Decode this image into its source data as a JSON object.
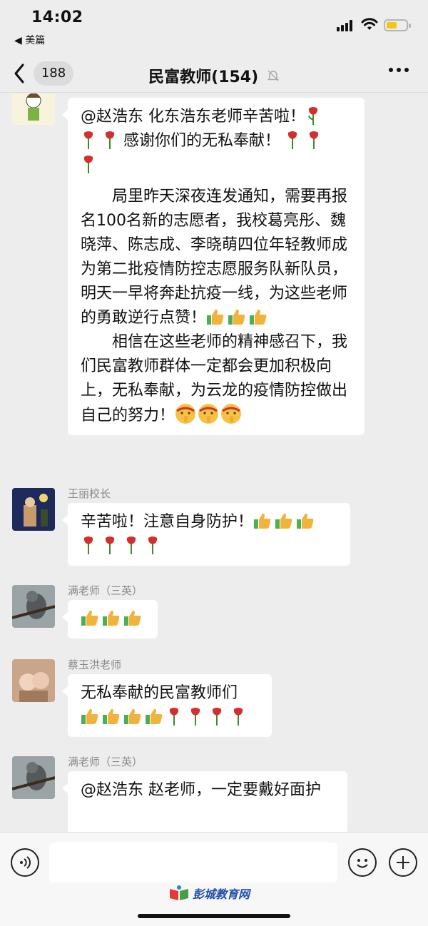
{
  "status_bar": {
    "time": "14:02",
    "back_app": "◀ 美篇",
    "battery_color": "#f5c518"
  },
  "nav": {
    "back_icon": "chevron-left-icon",
    "unread_count": "188",
    "title": "民富教师(154)",
    "mute_icon": "bell-muted-icon",
    "more_icon": "ellipsis-icon"
  },
  "messages": [
    {
      "sender": "",
      "lines": [
        "@赵浩东 化东浩东老师辛苦啦！",
        "感谢你们的无私奉献！",
        "局里昨天深夜连发通知，需要再报名100名新的志愿者，我校葛亮彤、魏晓萍、陈志成、李晓萌四位年轻教师成为第二批疫情防控志愿服务队新队员，明天一早将奔赴抗疫一线，为这些老师的勇敢逆行点赞！",
        "相信在这些老师的精神感召下，我们民富教师群体一定都会更加积极向上，无私奉献，为云龙的疫情防控做出自己的努力！"
      ]
    },
    {
      "sender": "王丽校长",
      "lines": [
        "辛苦啦！注意自身防护！"
      ]
    },
    {
      "sender": "满老师（三英）",
      "lines": []
    },
    {
      "sender": "蔡玉洪老师",
      "lines": [
        "无私奉献的民富教师们"
      ]
    },
    {
      "sender": "满老师（三英）",
      "lines": [
        "@赵浩东 赵老师，一定要戴好面护"
      ]
    }
  ],
  "input": {
    "placeholder": "",
    "voice_icon": "voice-icon",
    "emoji_icon": "smiley-icon",
    "plus_icon": "plus-icon"
  },
  "watermark": "彭城教育网",
  "colors": {
    "background": "#ededed",
    "bubble": "#ffffff",
    "thumb": "#f2b33d",
    "rose": "#d32f2f"
  }
}
